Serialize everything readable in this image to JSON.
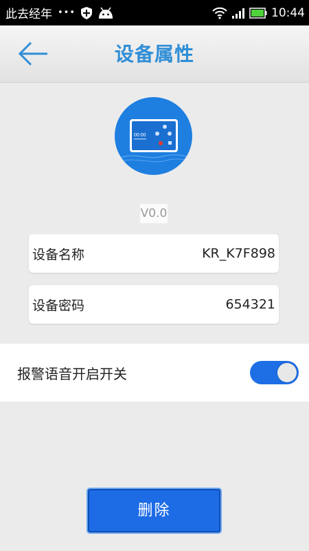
{
  "status_bar": {
    "left_text": "此去经年",
    "dots": "•••",
    "time": "10:44"
  },
  "header": {
    "title": "设备属性"
  },
  "device": {
    "version": "V0.0"
  },
  "info": {
    "name_label": "设备名称",
    "name_value": "KR_K7F898",
    "pwd_label": "设备密码",
    "pwd_value": "654321"
  },
  "alarm_voice": {
    "label": "报警语音开启开关",
    "enabled": true
  },
  "actions": {
    "delete_label": "删除"
  },
  "colors": {
    "accent": "#2f8ed6",
    "button": "#1d6ce6",
    "switch_on": "#1e6fe6"
  }
}
